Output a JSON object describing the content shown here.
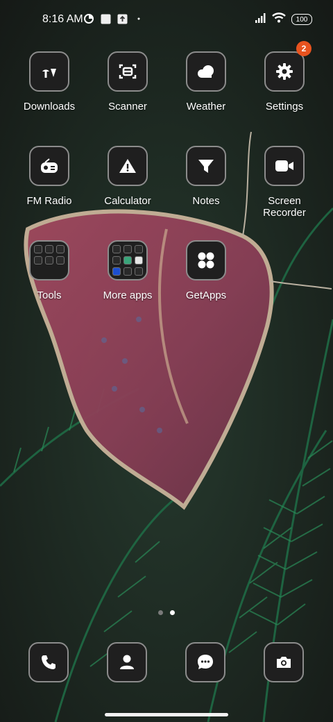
{
  "status_bar": {
    "time": "8:16 AM",
    "left_icons": [
      "data-saver-icon",
      "notification-square-icon",
      "upload-icon",
      "dot-icon"
    ],
    "right_icons": [
      "signal-icon",
      "wifi-icon"
    ],
    "battery": "100"
  },
  "apps": [
    {
      "label": "Downloads",
      "icon": "downloads-icon"
    },
    {
      "label": "Scanner",
      "icon": "scanner-icon"
    },
    {
      "label": "Weather",
      "icon": "weather-icon"
    },
    {
      "label": "Settings",
      "icon": "gear-icon",
      "badge": "2"
    },
    {
      "label": "FM Radio",
      "icon": "radio-icon"
    },
    {
      "label": "Calculator",
      "icon": "calculator-icon"
    },
    {
      "label": "Notes",
      "icon": "notes-icon"
    },
    {
      "label": "Screen Recorder",
      "icon": "video-icon"
    },
    {
      "label": "Tools",
      "icon": "folder-icon"
    },
    {
      "label": "More apps",
      "icon": "folder-icon"
    },
    {
      "label": "GetApps",
      "icon": "getapps-icon"
    }
  ],
  "page_indicator": {
    "count": 2,
    "active": 2
  },
  "dock": [
    {
      "name": "phone",
      "icon": "phone-icon"
    },
    {
      "name": "contacts",
      "icon": "contact-icon"
    },
    {
      "name": "messages",
      "icon": "chat-icon"
    },
    {
      "name": "camera",
      "icon": "camera-icon"
    }
  ],
  "colors": {
    "badge": "#e8531f",
    "tile_bg": "#1f1f1f",
    "tile_border": "#8c8c8c"
  }
}
